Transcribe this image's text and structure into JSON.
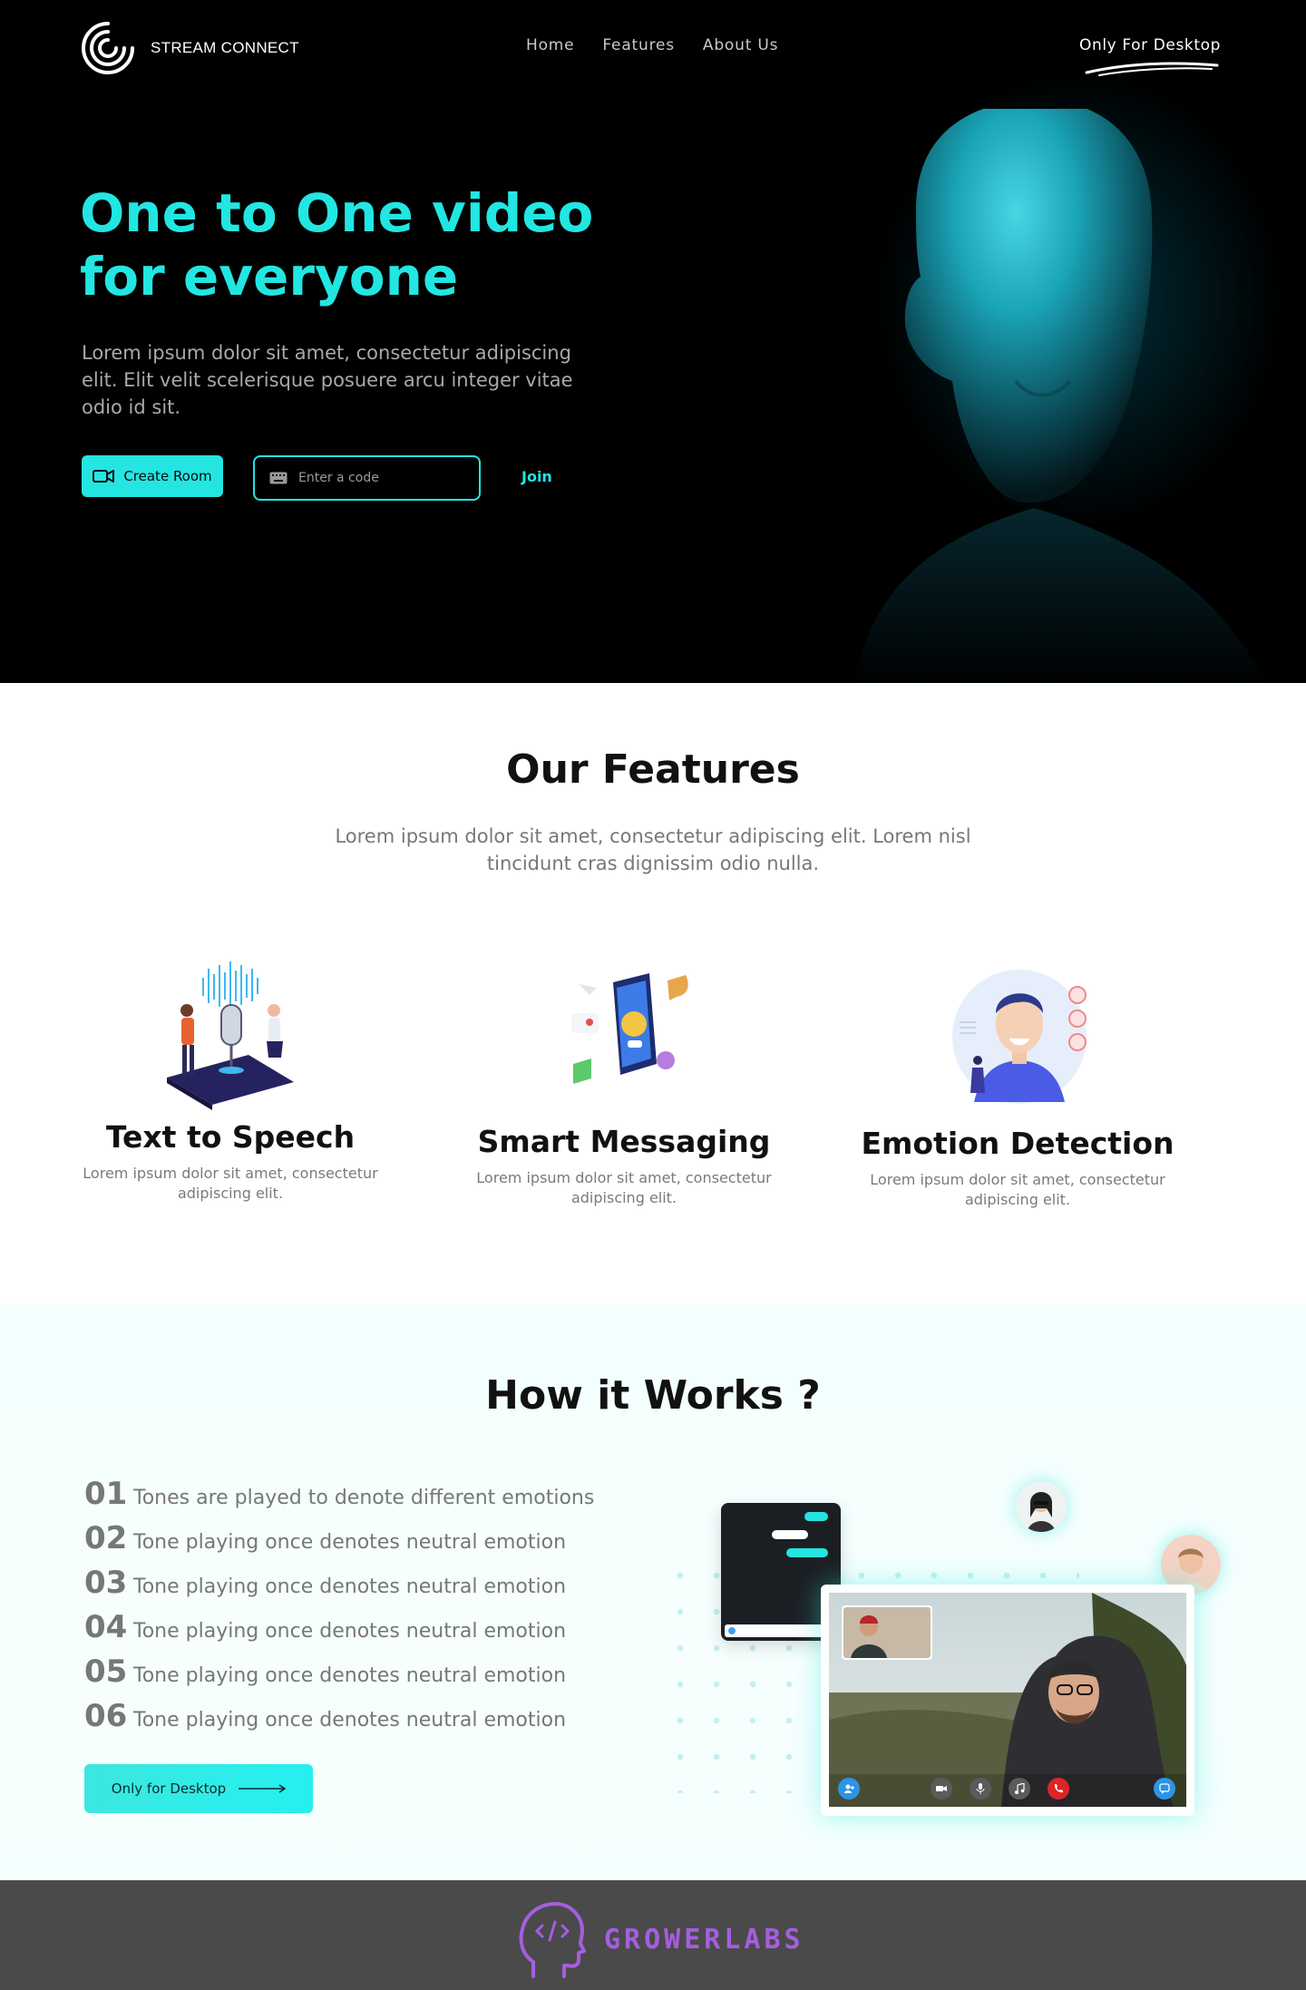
{
  "brand": {
    "name": "STREAM CONNECT"
  },
  "nav": {
    "links": [
      "Home",
      "Features",
      "About Us"
    ],
    "desktop_label": "Only For Desktop"
  },
  "hero": {
    "title": "One to One video for everyone",
    "description": "Lorem ipsum dolor sit amet, consectetur adipiscing elit. Elit velit scelerisque posuere arcu integer vitae odio id sit.",
    "create_room_label": "Create Room",
    "code_placeholder": "Enter a code",
    "join_label": "Join"
  },
  "features": {
    "title": "Our Features",
    "description": "Lorem ipsum dolor sit amet, consectetur adipiscing elit. Lorem nisl tincidunt cras dignissim odio nulla.",
    "items": [
      {
        "title": "Text to Speech",
        "description": "Lorem ipsum dolor sit amet, consectetur adipiscing elit."
      },
      {
        "title": "Smart Messaging",
        "description": "Lorem ipsum dolor sit amet, consectetur adipiscing elit."
      },
      {
        "title": "Emotion Detection",
        "description": "Lorem ipsum dolor sit amet, consectetur adipiscing elit."
      }
    ]
  },
  "how": {
    "title": "How it Works ?",
    "steps": [
      {
        "num": "01",
        "text": "Tones are played to denote different emotions"
      },
      {
        "num": "02",
        "text": "Tone playing once denotes neutral emotion"
      },
      {
        "num": "03",
        "text": "Tone playing once denotes neutral emotion"
      },
      {
        "num": "04",
        "text": "Tone playing once denotes neutral emotion"
      },
      {
        "num": "05",
        "text": "Tone playing once denotes neutral emotion"
      },
      {
        "num": "06",
        "text": "Tone playing once denotes neutral emotion"
      }
    ],
    "button_label": "Only for Desktop"
  },
  "footer": {
    "brand": "GROWERLABS"
  },
  "colors": {
    "accent": "#24e5e2",
    "footer_brand": "#a55ee0",
    "footer_bg": "#4a4a4a"
  },
  "icons": [
    "logo-icon",
    "video-camera-icon",
    "keyboard-icon",
    "arrow-right-icon",
    "add-user-icon",
    "camera-icon",
    "mic-icon",
    "music-icon",
    "end-call-icon",
    "chat-icon",
    "brain-code-icon"
  ]
}
